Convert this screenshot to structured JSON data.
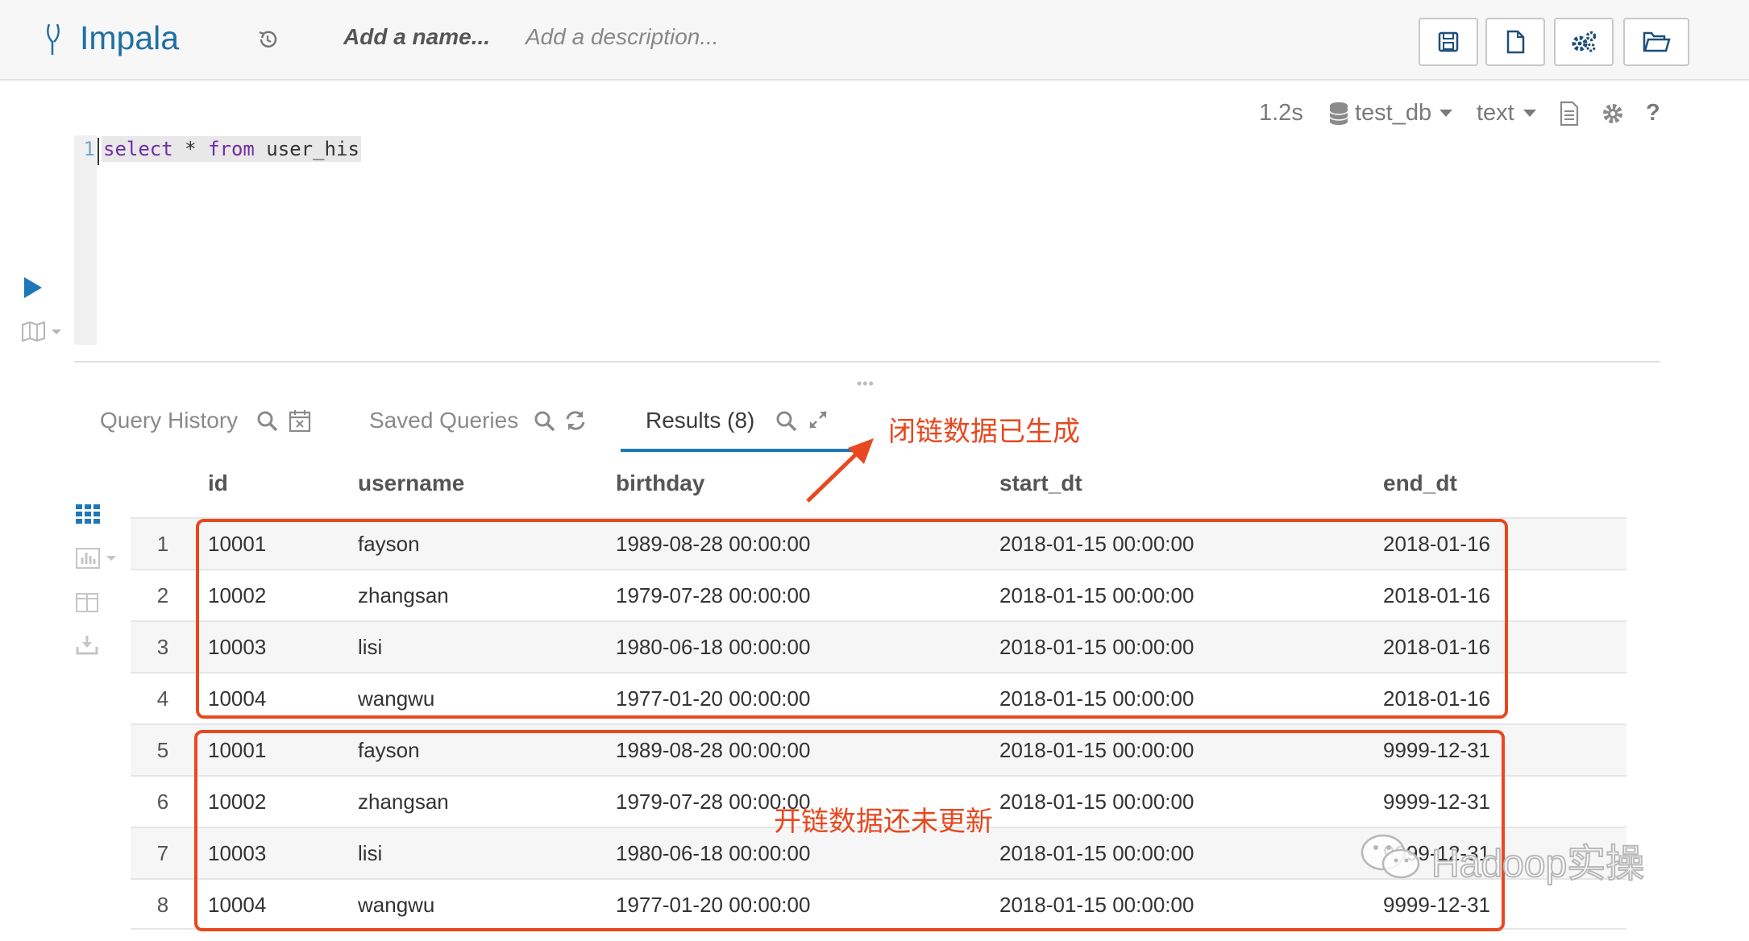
{
  "header": {
    "app_name": "Impala",
    "name_placeholder": "Add a name...",
    "description_placeholder": "Add a description..."
  },
  "toolbar": {
    "exec_time": "1.2s",
    "database": "test_db",
    "format": "text",
    "help": "?"
  },
  "editor": {
    "line_number": "1",
    "kw_select": "select",
    "star": " * ",
    "kw_from": "from",
    "table": " user_his"
  },
  "tabs": {
    "query_history": "Query History",
    "saved_queries": "Saved Queries",
    "results": "Results (8)"
  },
  "table": {
    "columns": [
      "id",
      "username",
      "birthday",
      "start_dt",
      "end_dt"
    ],
    "rows": [
      [
        "1",
        "10001",
        "fayson",
        "1989-08-28 00:00:00",
        "2018-01-15 00:00:00",
        "2018-01-16"
      ],
      [
        "2",
        "10002",
        "zhangsan",
        "1979-07-28 00:00:00",
        "2018-01-15 00:00:00",
        "2018-01-16"
      ],
      [
        "3",
        "10003",
        "lisi",
        "1980-06-18 00:00:00",
        "2018-01-15 00:00:00",
        "2018-01-16"
      ],
      [
        "4",
        "10004",
        "wangwu",
        "1977-01-20 00:00:00",
        "2018-01-15 00:00:00",
        "2018-01-16"
      ],
      [
        "5",
        "10001",
        "fayson",
        "1989-08-28 00:00:00",
        "2018-01-15 00:00:00",
        "9999-12-31"
      ],
      [
        "6",
        "10002",
        "zhangsan",
        "1979-07-28 00:00:00",
        "2018-01-15 00:00:00",
        "9999-12-31"
      ],
      [
        "7",
        "10003",
        "lisi",
        "1980-06-18 00:00:00",
        "2018-01-15 00:00:00",
        "9999-12-31"
      ],
      [
        "8",
        "10004",
        "wangwu",
        "1977-01-20 00:00:00",
        "2018-01-15 00:00:00",
        "9999-12-31"
      ]
    ]
  },
  "annotations": {
    "closed_chain": "闭链数据已生成",
    "open_chain": "开链数据还未更新"
  },
  "watermark": "Hadoop实操",
  "colors": {
    "accent": "#1d77b9",
    "annotation": "#e8481f"
  }
}
